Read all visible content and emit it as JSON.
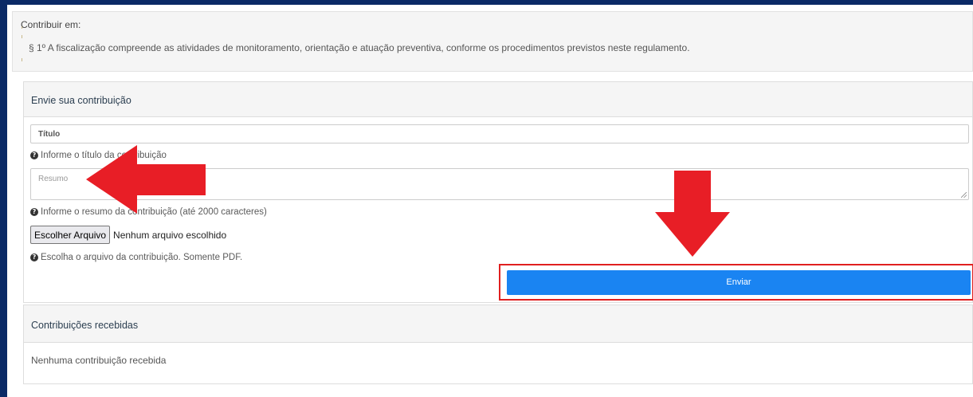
{
  "top_panel": {
    "title": "Contribuir em:",
    "paragraph": "§ 1º  A fiscalização compreende as atividades de monitoramento, orientação e atuação preventiva, conforme os procedimentos previstos neste regulamento."
  },
  "form": {
    "header": "Envie sua contribuição",
    "title_placeholder": "Título",
    "title_help": "Informe o título da contribuição",
    "summary_placeholder": "Resumo",
    "summary_help": "Informe o resumo da contribuição (até 2000 caracteres)",
    "file_button": "Escolher Arquivo",
    "file_status": "Nenhum arquivo escolhido",
    "file_help": "Escolha o arquivo da contribuição. Somente PDF.",
    "submit_label": "Enviar"
  },
  "received": {
    "header": "Contribuições recebidas",
    "empty_text": "Nenhuma contribuição recebida"
  },
  "icons": {
    "help": "question-circle-icon",
    "annotation_left": "arrow-left-icon",
    "annotation_down": "arrow-down-icon"
  },
  "colors": {
    "frame": "#0b2a66",
    "primary_button": "#1a84f2",
    "annotation": "#e81e26",
    "highlight_border": "#e02020"
  }
}
